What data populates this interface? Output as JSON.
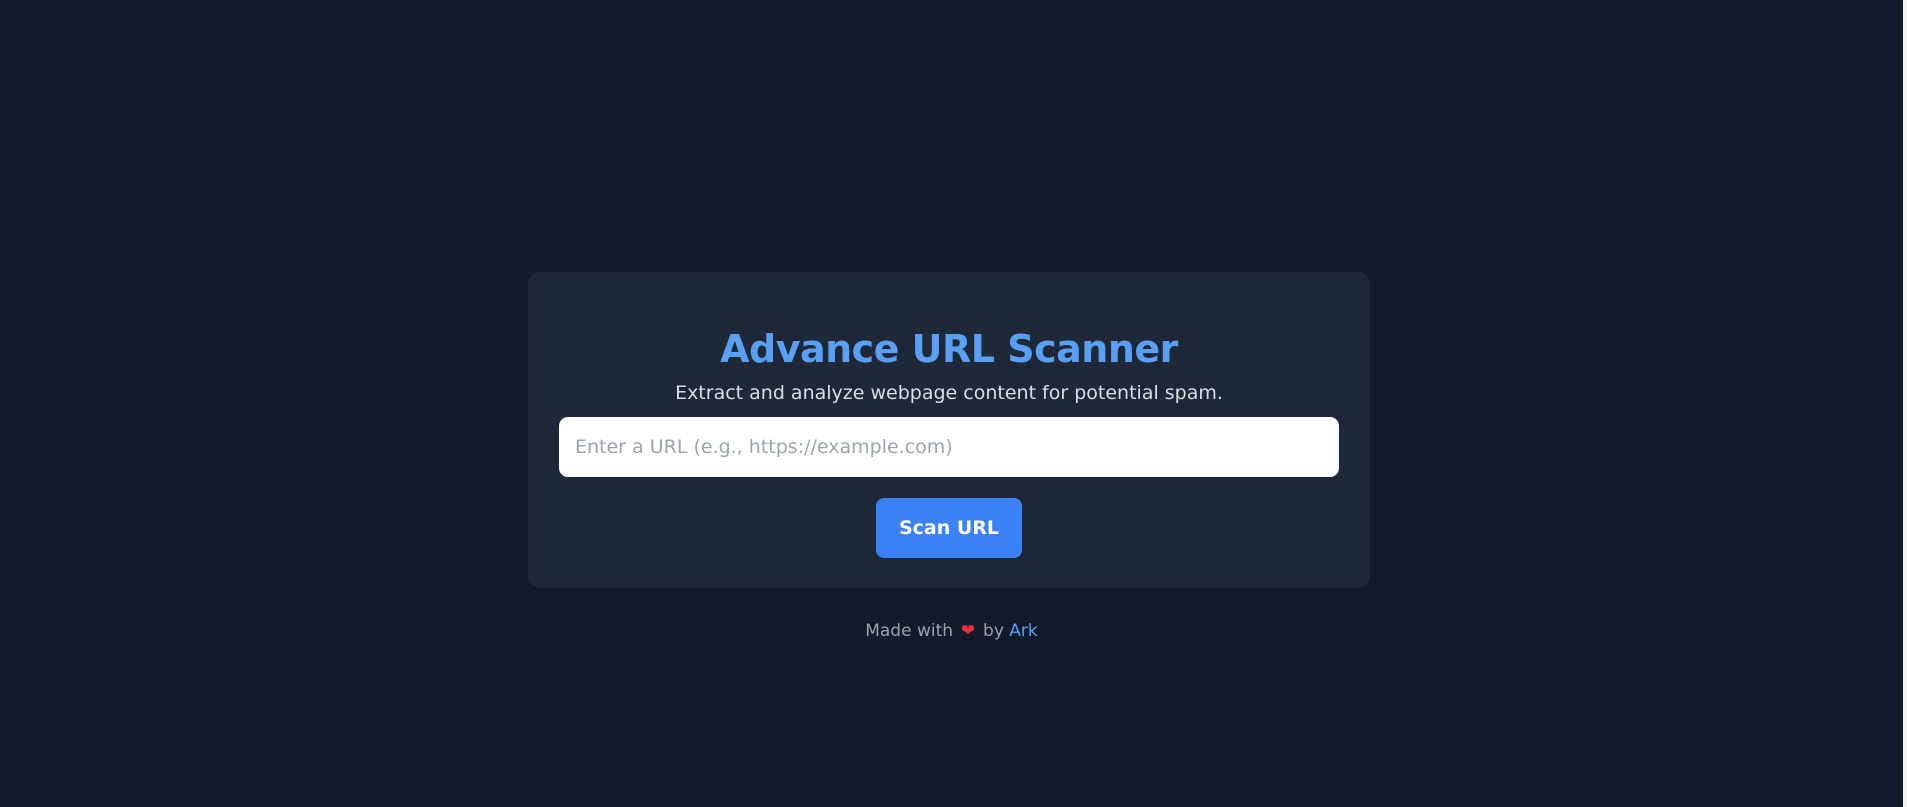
{
  "app": {
    "title": "Advance URL Scanner",
    "subtitle": "Extract and analyze webpage content for potential spam."
  },
  "form": {
    "url_placeholder": "Enter a URL (e.g., https://example.com)",
    "url_value": "",
    "scan_button_label": "Scan URL"
  },
  "footer": {
    "prefix": "Made with",
    "heart_icon": "heart-icon",
    "heart_glyph": "❤",
    "by_text": "by",
    "author_link": "Ark"
  },
  "colors": {
    "page_background": "#131a29",
    "card_background": "#1f2838",
    "accent": "#5aa0f2",
    "button": "#3b82f6",
    "heart": "#ef2d45"
  }
}
